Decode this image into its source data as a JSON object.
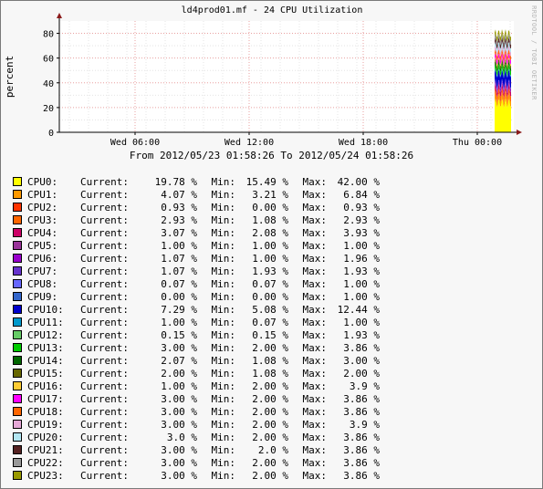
{
  "title": "ld4prod01.mf - 24 CPU Utilization",
  "vertical_label": "percent",
  "watermark": "RRDTOOL / TOBI OETIKER",
  "time_range": "From 2012/05/23 01:58:26 To 2012/05/24 01:58:26",
  "labels": {
    "current": "Current:",
    "min": "Min:",
    "max": "Max:",
    "unit": "%"
  },
  "chart_data": {
    "type": "area",
    "stacked": true,
    "title": "ld4prod01.mf - 24 CPU Utilization",
    "ylabel": "percent",
    "xlabel": "",
    "ylim": [
      0,
      90
    ],
    "y_ticks": [
      0,
      20,
      40,
      60,
      80
    ],
    "x_ticks": [
      "Wed 06:00",
      "Wed 12:00",
      "Wed 18:00",
      "Thu 00:00"
    ],
    "grid": true,
    "note": "Data present only in the last ~1 hour (Thu ~00:50 to 01:58); stacked total ranges roughly 55–80 percent.",
    "series": [
      {
        "name": "CPU0:",
        "color": "#FFFF00",
        "current": "19.78",
        "min": "15.49",
        "max": "42.00"
      },
      {
        "name": "CPU1:",
        "color": "#FF9900",
        "current": "4.07",
        "min": "3.21",
        "max": "6.84"
      },
      {
        "name": "CPU2:",
        "color": "#FF3300",
        "current": "0.93",
        "min": "0.00",
        "max": "0.93"
      },
      {
        "name": "CPU3:",
        "color": "#FF6600",
        "current": "2.93",
        "min": "1.08",
        "max": "2.93"
      },
      {
        "name": "CPU4:",
        "color": "#CC0066",
        "current": "3.07",
        "min": "2.08",
        "max": "3.93"
      },
      {
        "name": "CPU5:",
        "color": "#993399",
        "current": "1.00",
        "min": "1.00",
        "max": "1.00"
      },
      {
        "name": "CPU6:",
        "color": "#9900CC",
        "current": "1.07",
        "min": "1.00",
        "max": "1.96"
      },
      {
        "name": "CPU7:",
        "color": "#6633CC",
        "current": "1.07",
        "min": "1.93",
        "max": "1.93"
      },
      {
        "name": "CPU8:",
        "color": "#6666FF",
        "current": "0.07",
        "min": "0.07",
        "max": "1.00"
      },
      {
        "name": "CPU9:",
        "color": "#3366CC",
        "current": "0.00",
        "min": "0.00",
        "max": "1.00"
      },
      {
        "name": "CPU10:",
        "color": "#0000CC",
        "current": "7.29",
        "min": "5.08",
        "max": "12.44"
      },
      {
        "name": "CPU11:",
        "color": "#0099CC",
        "current": "1.00",
        "min": "0.07",
        "max": "1.00"
      },
      {
        "name": "CPU12:",
        "color": "#66CC66",
        "current": "0.15",
        "min": "0.15",
        "max": "1.93"
      },
      {
        "name": "CPU13:",
        "color": "#00CC00",
        "current": "3.00",
        "min": "2.00",
        "max": "3.86"
      },
      {
        "name": "CPU14:",
        "color": "#006600",
        "current": "2.07",
        "min": "1.08",
        "max": "3.00"
      },
      {
        "name": "CPU15:",
        "color": "#666600",
        "current": "2.00",
        "min": "1.08",
        "max": "2.00"
      },
      {
        "name": "CPU16:",
        "color": "#FFCC33",
        "current": "1.00",
        "min": "2.00",
        "max": "3.9"
      },
      {
        "name": "CPU17:",
        "color": "#FF00FF",
        "current": "3.00",
        "min": "2.00",
        "max": "3.86"
      },
      {
        "name": "CPU18:",
        "color": "#FF6600",
        "current": "3.00",
        "min": "2.00",
        "max": "3.86"
      },
      {
        "name": "CPU19:",
        "color": "#E6A8D7",
        "current": "3.00",
        "min": "2.00",
        "max": "3.9"
      },
      {
        "name": "CPU20:",
        "color": "#B3E6F2",
        "current": "3.0",
        "min": "2.00",
        "max": "3.86"
      },
      {
        "name": "CPU21:",
        "color": "#552222",
        "current": "3.00",
        "min": "2.0",
        "max": "3.86"
      },
      {
        "name": "CPU22:",
        "color": "#999999",
        "current": "3.00",
        "min": "2.00",
        "max": "3.86"
      },
      {
        "name": "CPU23:",
        "color": "#999900",
        "current": "3.00",
        "min": "2.00",
        "max": "3.86"
      }
    ]
  }
}
